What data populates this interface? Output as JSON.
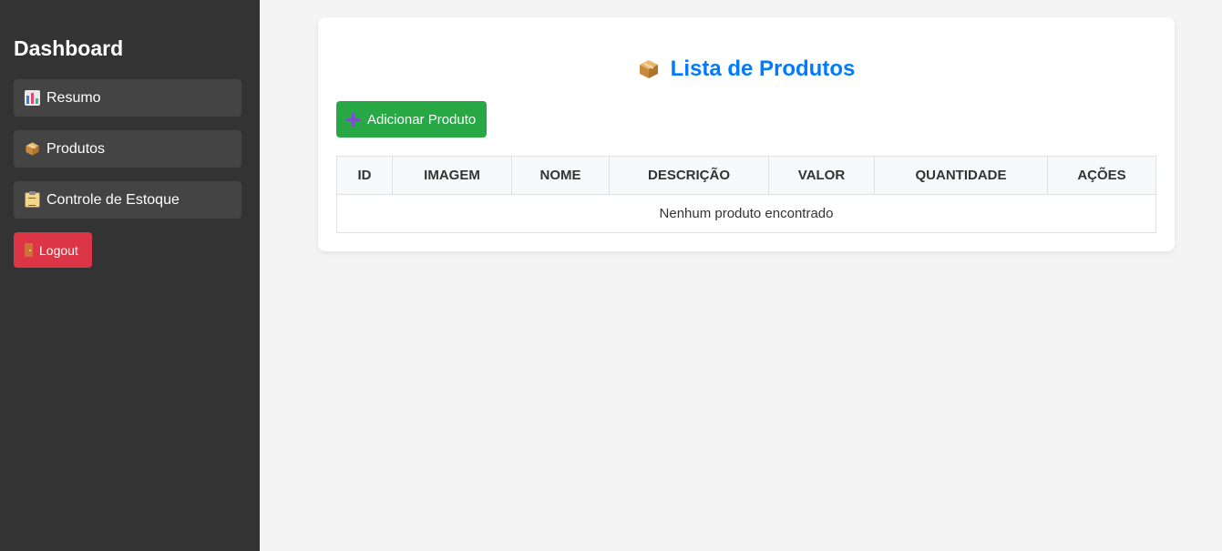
{
  "sidebar": {
    "title": "Dashboard",
    "items": [
      {
        "label": "Resumo",
        "icon": "bar-chart-icon"
      },
      {
        "label": "Produtos",
        "icon": "package-icon"
      },
      {
        "label": "Controle de Estoque",
        "icon": "clipboard-icon"
      }
    ],
    "logout_label": "Logout",
    "logout_icon": "door-icon"
  },
  "main": {
    "title": "Lista de Produtos",
    "title_icon": "package-icon",
    "add_button_label": "Adicionar Produto",
    "add_button_icon": "plus-icon",
    "table": {
      "columns": [
        "ID",
        "IMAGEM",
        "NOME",
        "DESCRIÇÃO",
        "VALOR",
        "QUANTIDADE",
        "AÇÕES"
      ],
      "empty_message": "Nenhum produto encontrado"
    }
  },
  "colors": {
    "sidebar_bg": "#333333",
    "nav_item_bg": "#444444",
    "logout": "#dc3545",
    "accent": "#007bff",
    "add_button": "#28a745"
  }
}
